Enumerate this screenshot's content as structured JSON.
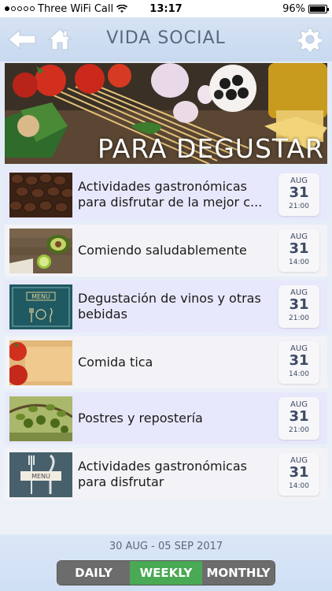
{
  "status_bar": {
    "carrier": "Three WiFi Call",
    "time": "13:17",
    "battery": "96%",
    "battery_level": 0.96
  },
  "header": {
    "title": "VIDA SOCIAL",
    "back_icon": "back-arrow-icon",
    "home_icon": "home-icon",
    "settings_icon": "gear-icon"
  },
  "banner": {
    "title": "PARA DEGUSTAR"
  },
  "events": [
    {
      "title": "Actividades gastronómicas para disfrutar de la mejor c...",
      "month": "AUG",
      "day": "31",
      "time": "21:00",
      "thumb": "coffee-beans"
    },
    {
      "title": "Comiendo saludablemente",
      "month": "AUG",
      "day": "31",
      "time": "14:00",
      "thumb": "avocado-lime"
    },
    {
      "title": "Degustación de vinos y otras bebidas",
      "month": "AUG",
      "day": "31",
      "time": "21:00",
      "thumb": "menu-board"
    },
    {
      "title": "Comida tica",
      "month": "AUG",
      "day": "31",
      "time": "14:00",
      "thumb": "tomatoes"
    },
    {
      "title": "Postres y repostería",
      "month": "AUG",
      "day": "31",
      "time": "21:00",
      "thumb": "olives"
    },
    {
      "title": "Actividades gastronómicas para disfrutar",
      "month": "AUG",
      "day": "31",
      "time": "14:00",
      "thumb": "menu-cutlery"
    }
  ],
  "footer": {
    "date_range": "30 AUG - 05 SEP 2017",
    "tabs": [
      {
        "label": "DAILY",
        "active": false
      },
      {
        "label": "WEEKLY",
        "active": true
      },
      {
        "label": "MONTHLY",
        "active": false
      }
    ]
  },
  "colors": {
    "accent_active": "#4aa954",
    "tab_inactive": "#6c6c6c",
    "header_text": "#5a6780"
  }
}
